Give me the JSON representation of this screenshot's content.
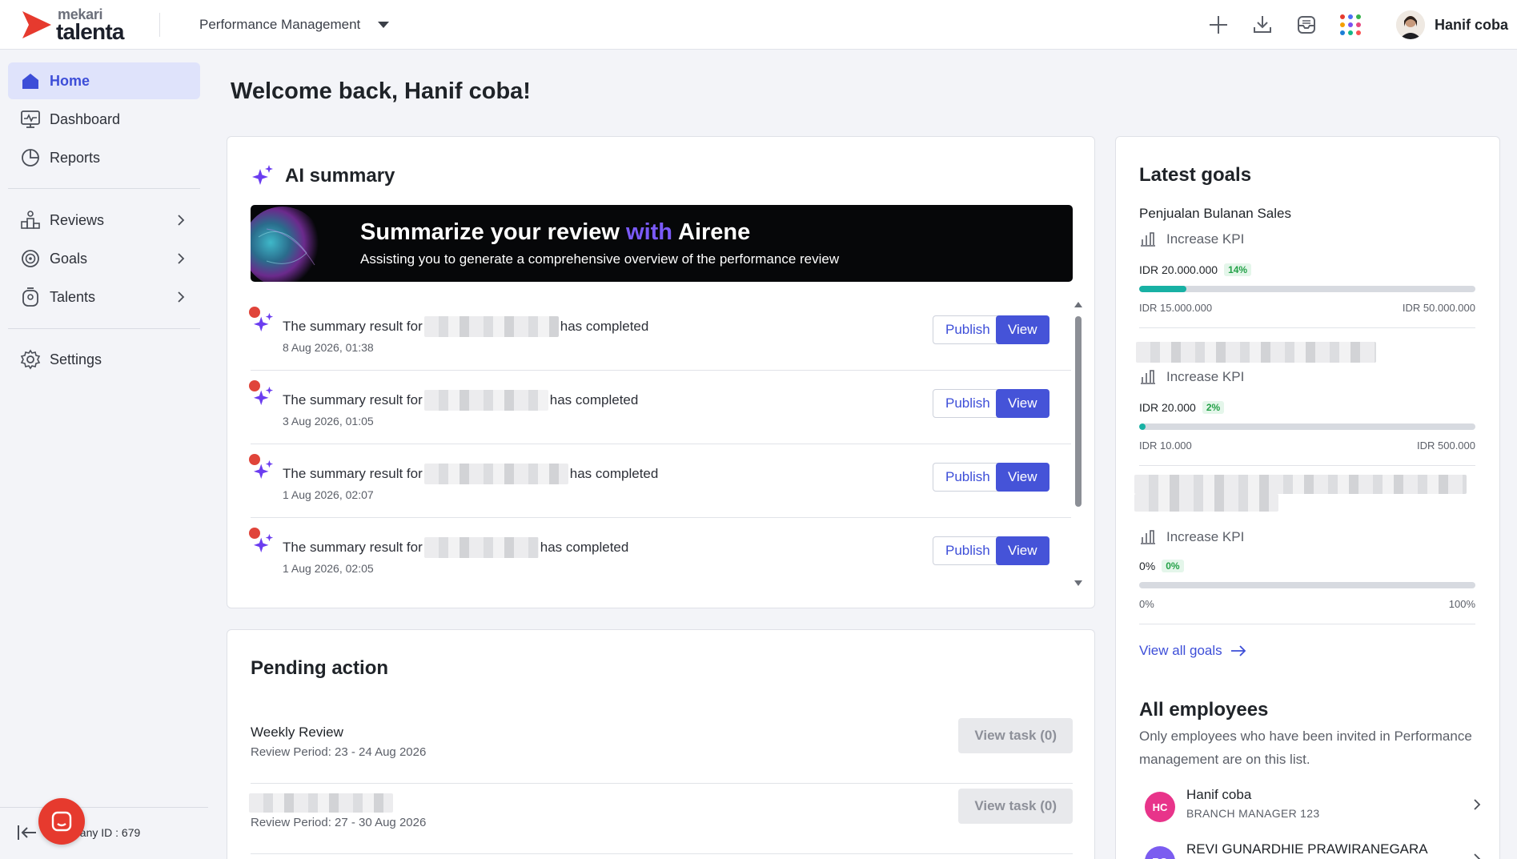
{
  "brand": {
    "small": "mekari",
    "big": "talenta",
    "accent": "#e63a2e"
  },
  "header": {
    "module": "Performance Management",
    "icons": [
      "plus-icon",
      "download-icon",
      "inbox-icon",
      "apps-grid-icon"
    ],
    "user_name": "Hanif coba"
  },
  "sidebar": {
    "items": [
      {
        "label": "Home",
        "icon": "home-icon",
        "active": true
      },
      {
        "label": "Dashboard",
        "icon": "dashboard-icon"
      },
      {
        "label": "Reports",
        "icon": "pie-chart-icon"
      },
      {
        "label": "Reviews",
        "icon": "reviews-icon",
        "has_children": true
      },
      {
        "label": "Goals",
        "icon": "target-icon",
        "has_children": true
      },
      {
        "label": "Talents",
        "icon": "talents-icon",
        "has_children": true
      },
      {
        "label": "Settings",
        "icon": "gear-icon"
      }
    ],
    "company_id": "pany ID : 679"
  },
  "main": {
    "welcome": "Welcome back, Hanif coba!",
    "ai_summary": {
      "title": "AI summary",
      "banner_title_a": "Summarize your review ",
      "banner_title_hl": "with",
      "banner_title_b": " Airene",
      "banner_sub": "Assisting you to generate a comprehensive overview of the performance review",
      "items": [
        {
          "prefix": "The summary result for",
          "suffix": "has completed",
          "date": "8 Aug 2026, 01:38"
        },
        {
          "prefix": "The summary result for",
          "suffix": "has completed",
          "date": "3 Aug 2026, 01:05"
        },
        {
          "prefix": "The summary result for",
          "suffix": "has completed",
          "date": "1 Aug 2026, 02:07"
        },
        {
          "prefix": "The summary result for",
          "suffix": "has completed",
          "date": "1 Aug 2026, 02:05"
        }
      ],
      "publish_label": "Publish",
      "view_label": "View"
    },
    "pending": {
      "title": "Pending action",
      "items": [
        {
          "title": "Weekly Review",
          "period": "Review Period: 23 - 24 Aug 2026",
          "button": "View task (0)"
        },
        {
          "title": "",
          "period": "Review Period: 27 - 30 Aug 2026",
          "button": "View task (0)"
        }
      ]
    }
  },
  "right": {
    "goals_title": "Latest goals",
    "goals": [
      {
        "name": "Penjualan Bulanan Sales",
        "kpi": "Increase KPI",
        "value": "IDR 20.000.000",
        "percent": "14%",
        "progress": 0.14,
        "min": "IDR 15.000.000",
        "max": "IDR 50.000.000"
      },
      {
        "name": "",
        "kpi": "Increase KPI",
        "value": "IDR 20.000",
        "percent": "2%",
        "progress": 0.02,
        "min": "IDR 10.000",
        "max": "IDR 500.000"
      },
      {
        "name": "",
        "kpi": "Increase KPI",
        "value": "0%",
        "percent": "0%",
        "progress": 0,
        "min": "0%",
        "max": "100%"
      }
    ],
    "view_all": "View all goals",
    "employees_title": "All employees",
    "employees_desc": "Only employees who have been invited in Performance management are on this list.",
    "employees": [
      {
        "initials": "HC",
        "name": "Hanif coba",
        "role": "BRANCH MANAGER 123",
        "color": "#e8348a"
      },
      {
        "initials": "RG",
        "name": "REVI GUNARDHIE PRAWIRANEGARA",
        "role": "",
        "color": "#7b5cf0"
      }
    ]
  }
}
